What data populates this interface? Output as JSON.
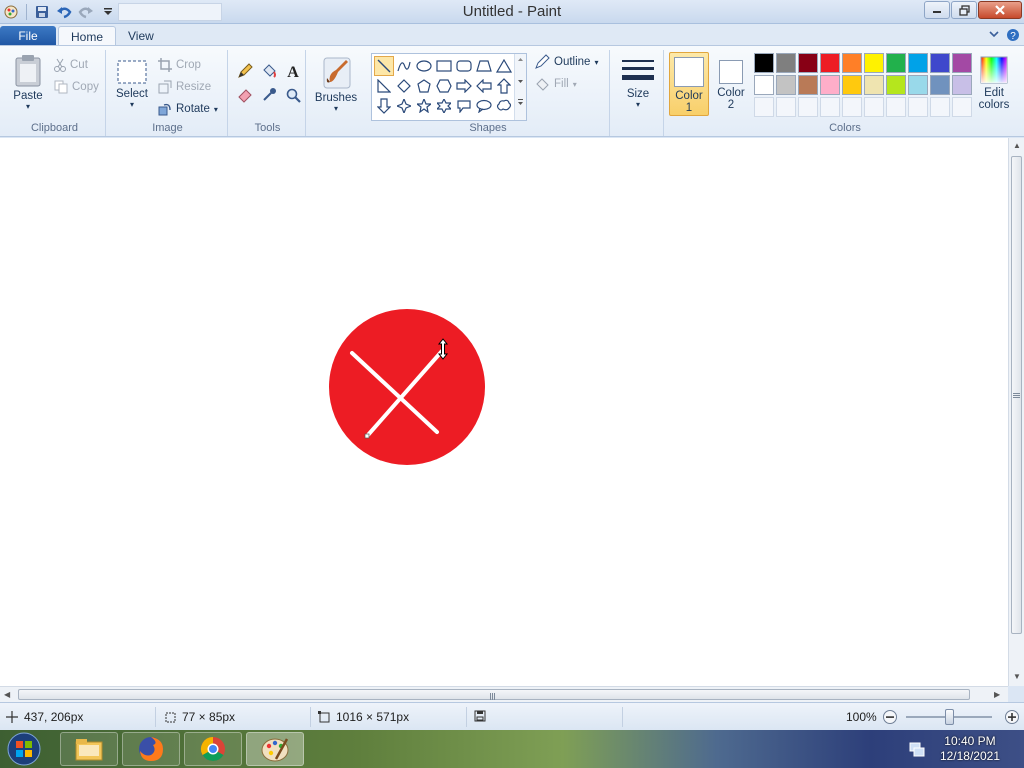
{
  "window": {
    "title": "Untitled - Paint"
  },
  "tabs": {
    "file": "File",
    "home": "Home",
    "view": "View"
  },
  "clipboard": {
    "group": "Clipboard",
    "paste": "Paste",
    "cut": "Cut",
    "copy": "Copy"
  },
  "image": {
    "group": "Image",
    "select": "Select",
    "crop": "Crop",
    "resize": "Resize",
    "rotate": "Rotate"
  },
  "tools": {
    "group": "Tools"
  },
  "brushes": {
    "label": "Brushes"
  },
  "shapes": {
    "group": "Shapes",
    "outline": "Outline",
    "fill": "Fill"
  },
  "size": {
    "label": "Size"
  },
  "colors": {
    "group": "Colors",
    "color1_label": "Color\n1",
    "color2_label": "Color\n2",
    "color1_line1": "Color",
    "color1_line2": "1",
    "color2_line1": "Color",
    "color2_line2": "2",
    "edit_line1": "Edit",
    "edit_line2": "colors",
    "color1_value": "#ffffff",
    "color2_value": "#ffffff",
    "palette": [
      "#000000",
      "#7f7f7f",
      "#880015",
      "#ed1c24",
      "#ff7f27",
      "#fff200",
      "#22b14c",
      "#00a2e8",
      "#3f48cc",
      "#a349a4",
      "#ffffff",
      "#c3c3c3",
      "#b97a57",
      "#ffaec9",
      "#ffc90e",
      "#efe4b0",
      "#b5e61d",
      "#99d9ea",
      "#7092be",
      "#c8bfe7"
    ]
  },
  "canvas": {
    "circle_color": "#ed1c24",
    "x_color": "#ffffff"
  },
  "status": {
    "cursor_pos": "437, 206px",
    "selection_size": "77 × 85px",
    "image_size": "1016 × 571px",
    "zoom": "100%"
  },
  "taskbar": {
    "time": "10:40 PM",
    "date": "12/18/2021"
  }
}
